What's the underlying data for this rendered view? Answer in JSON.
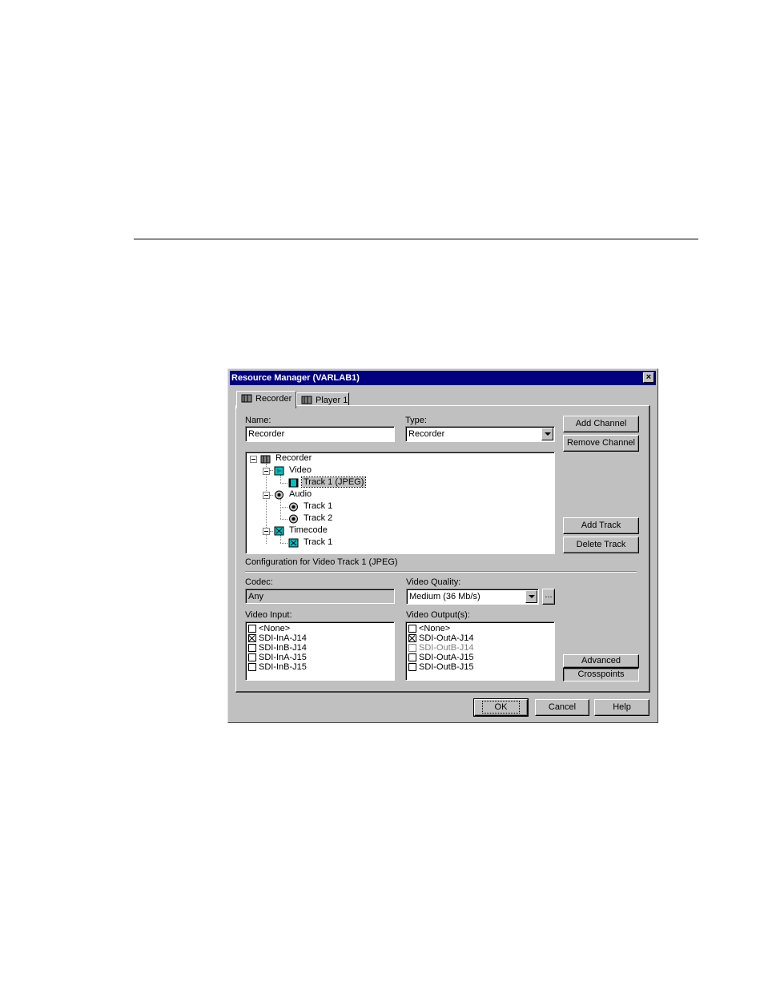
{
  "window": {
    "title": "Resource Manager (VARLAB1)"
  },
  "tabs": [
    {
      "label": "Recorder",
      "icon": "channel-icon",
      "active": true
    },
    {
      "label": "Player 1",
      "icon": "channel-icon",
      "active": false
    }
  ],
  "name_field": {
    "label": "Name:",
    "value": "Recorder"
  },
  "type_field": {
    "label": "Type:",
    "value": "Recorder"
  },
  "buttons": {
    "add_channel": "Add Channel",
    "remove_channel": "Remove Channel",
    "add_track": "Add Track",
    "delete_track": "Delete Track",
    "advanced": "Advanced",
    "crosspoints": "Crosspoints",
    "ok": "OK",
    "cancel": "Cancel",
    "help": "Help",
    "ellipsis": "..."
  },
  "tree": {
    "root": "Recorder",
    "video": "Video",
    "video_track": "Track 1 (JPEG)",
    "audio": "Audio",
    "audio_track1": "Track 1",
    "audio_track2": "Track 2",
    "timecode": "Timecode",
    "timecode_track": "Track 1"
  },
  "config_heading": "Configuration for Video Track 1 (JPEG)",
  "codec": {
    "label": "Codec:",
    "value": "Any"
  },
  "video_quality": {
    "label": "Video Quality:",
    "value": "Medium (36 Mb/s)"
  },
  "video_input": {
    "label": "Video Input:",
    "items": [
      {
        "label": "<None>",
        "checked": false
      },
      {
        "label": "SDI-InA-J14",
        "checked": true
      },
      {
        "label": "SDI-InB-J14",
        "checked": false
      },
      {
        "label": "SDI-InA-J15",
        "checked": false
      },
      {
        "label": "SDI-InB-J15",
        "checked": false
      }
    ]
  },
  "video_outputs": {
    "label": "Video Output(s):",
    "items": [
      {
        "label": "<None>",
        "checked": false,
        "disabled": false
      },
      {
        "label": "SDI-OutA-J14",
        "checked": true,
        "disabled": false
      },
      {
        "label": "SDI-OutB-J14",
        "checked": false,
        "disabled": true
      },
      {
        "label": "SDI-OutA-J15",
        "checked": false,
        "disabled": false
      },
      {
        "label": "SDI-OutB-J15",
        "checked": false,
        "disabled": false
      }
    ]
  },
  "colors": {
    "titlebar": "#000080",
    "face": "#c0c0c0"
  }
}
